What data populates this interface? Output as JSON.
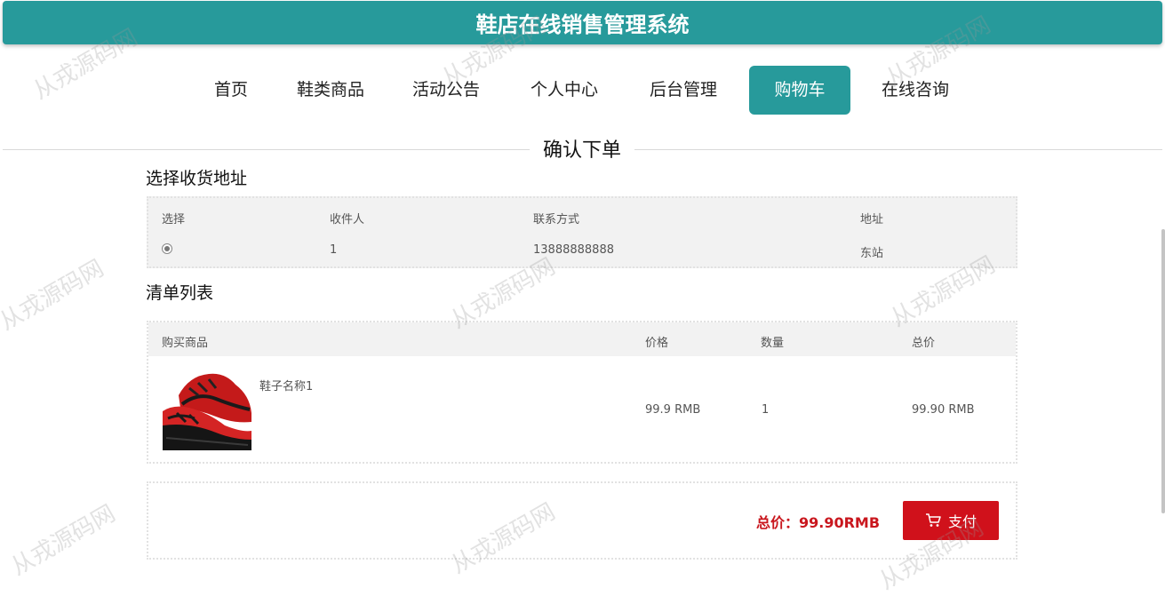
{
  "app": {
    "title": "鞋店在线销售管理系统"
  },
  "nav": {
    "items": [
      {
        "label": "首页"
      },
      {
        "label": "鞋类商品"
      },
      {
        "label": "活动公告"
      },
      {
        "label": "个人中心"
      },
      {
        "label": "后台管理"
      },
      {
        "label": "购物车",
        "active": true
      },
      {
        "label": "在线咨询"
      }
    ]
  },
  "page": {
    "title": "确认下单"
  },
  "address": {
    "section_title": "选择收货地址",
    "headers": [
      "选择",
      "收件人",
      "联系方式",
      "地址"
    ],
    "rows": [
      {
        "selected": true,
        "recipient": "1",
        "phone": "13888888888",
        "address": "东站"
      }
    ]
  },
  "items": {
    "section_title": "清单列表",
    "headers": [
      "购买商品",
      "价格",
      "数量",
      "总价"
    ],
    "rows": [
      {
        "name": "鞋子名称1",
        "price": "99.9 RMB",
        "quantity": "1",
        "subtotal": "99.90 RMB",
        "image_icon": "red-sneaker-image"
      }
    ]
  },
  "summary": {
    "total_text": "总价：99.90RMB",
    "pay_label": "支付",
    "pay_icon": "cart-icon"
  },
  "watermark": {
    "text": "从戎源码网"
  },
  "colors": {
    "accent": "#279a9b",
    "pay": "#d0111b",
    "total": "#c9171e"
  }
}
